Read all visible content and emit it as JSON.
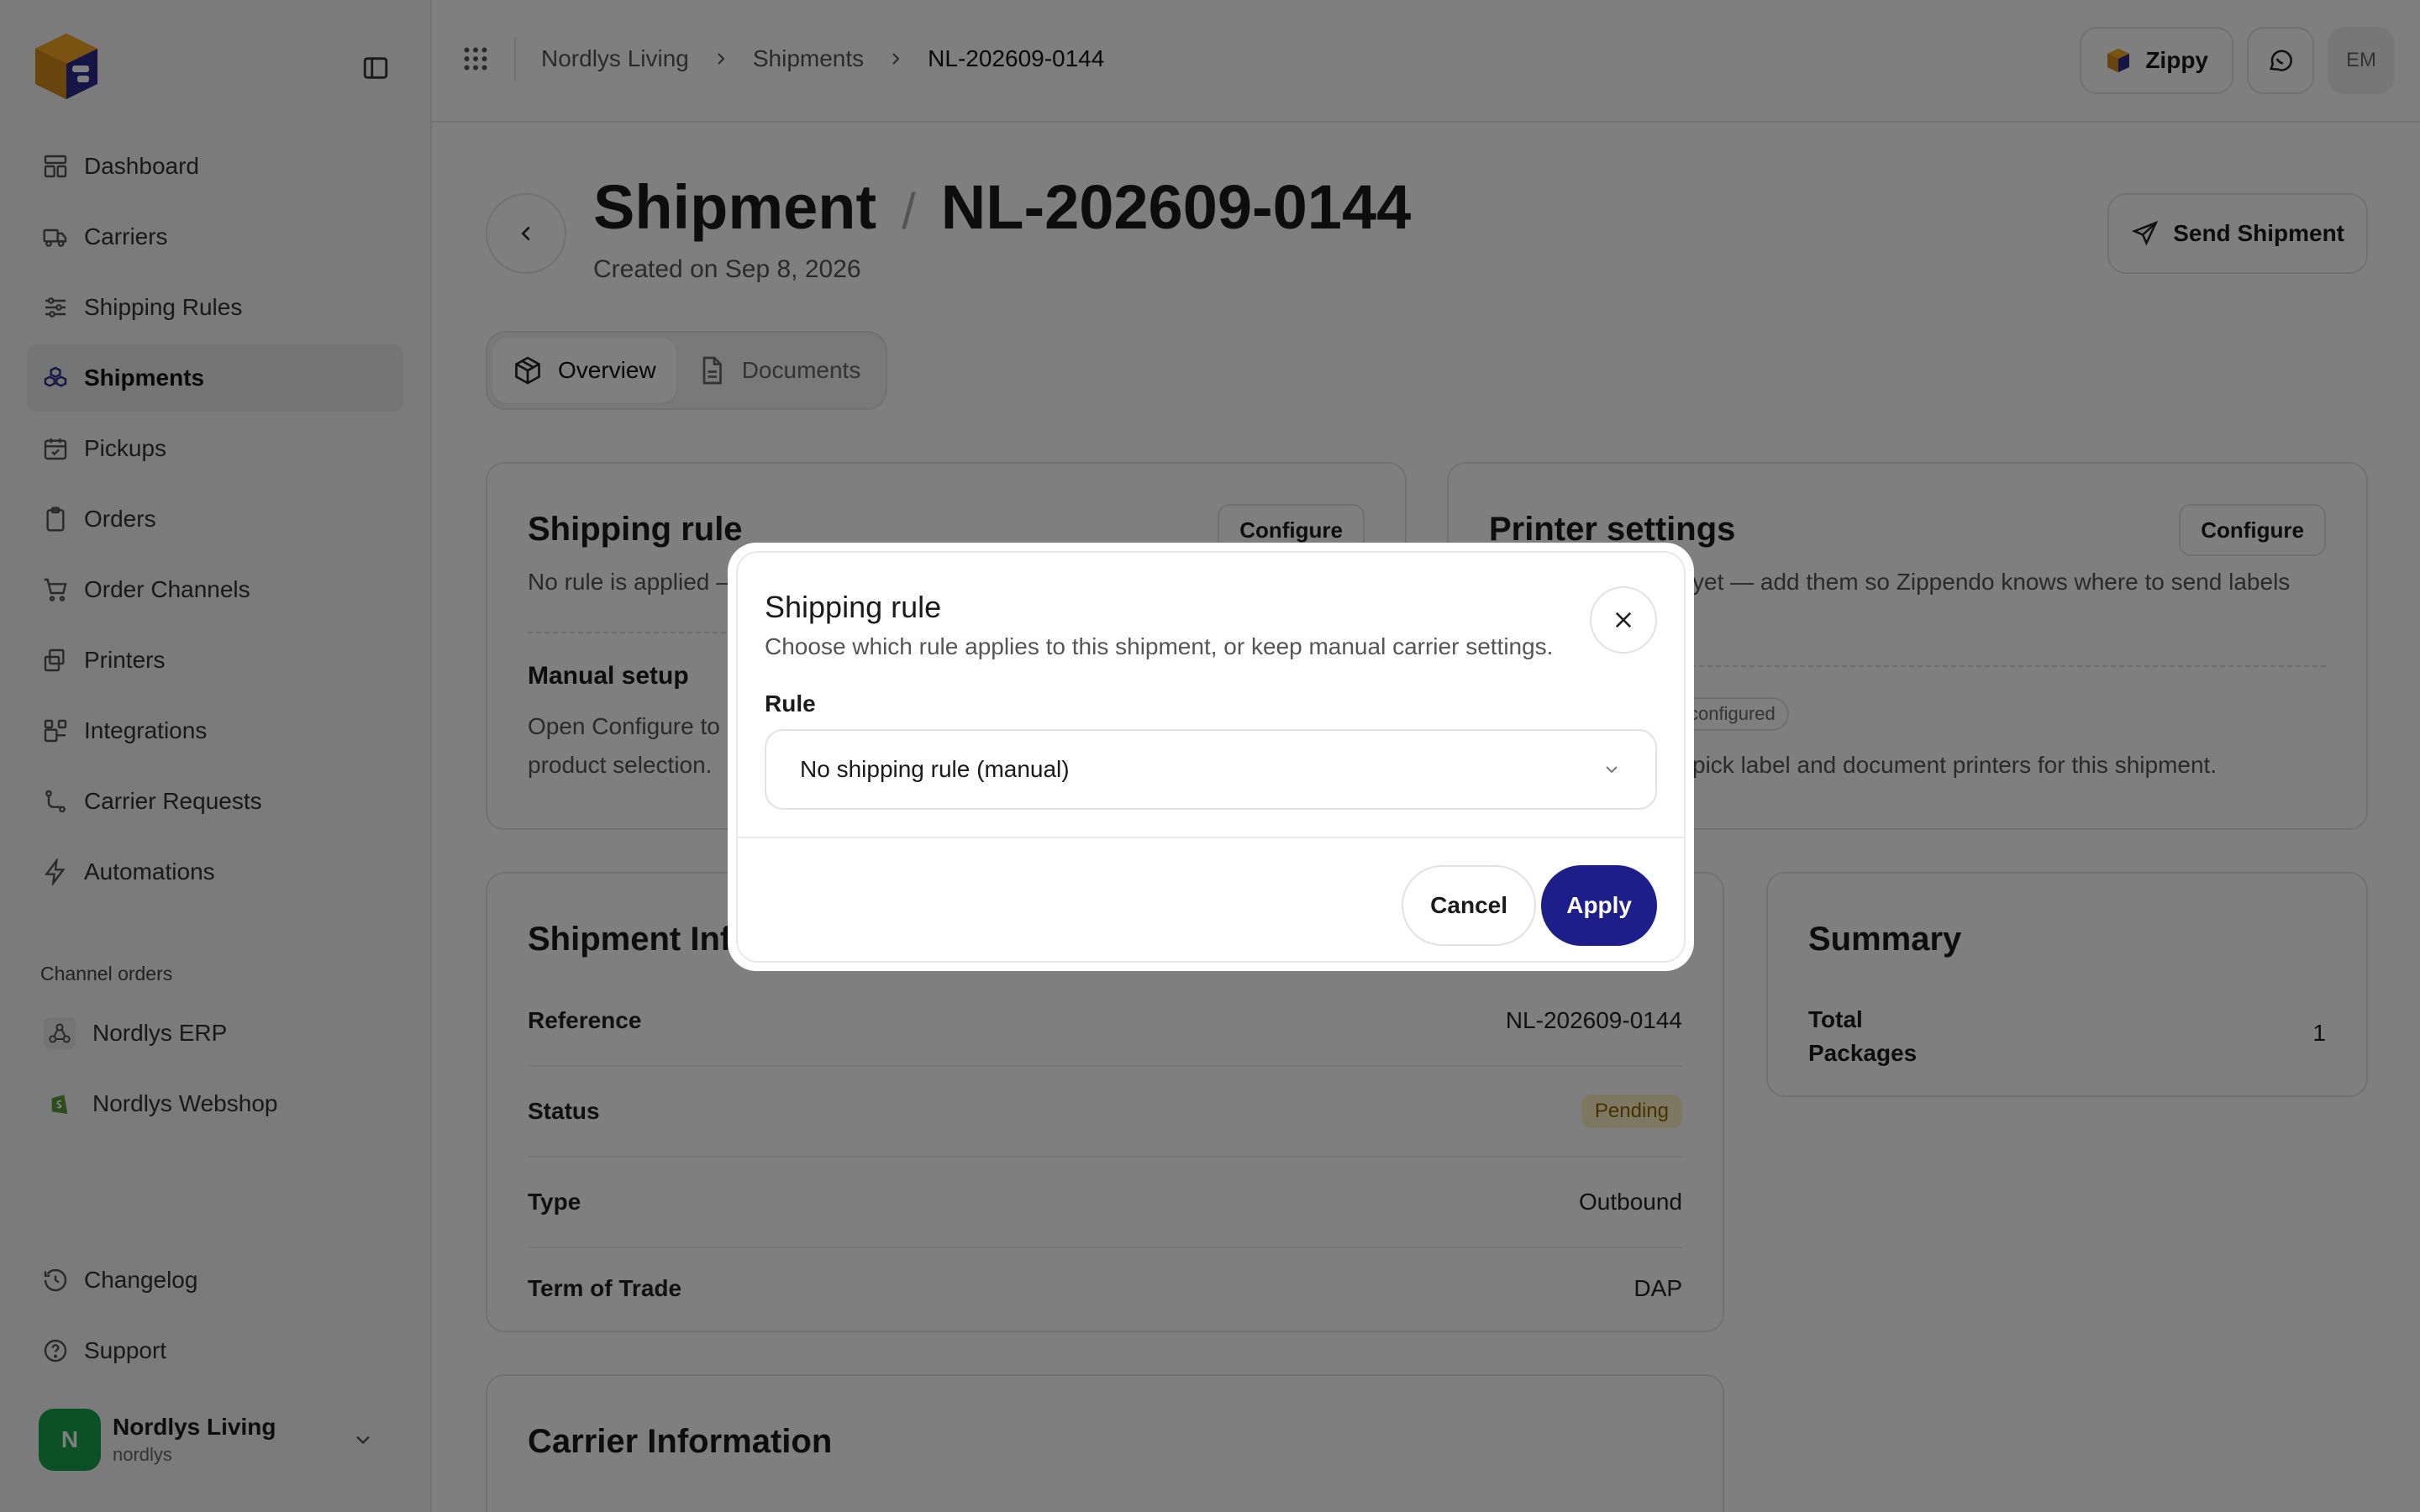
{
  "sidebar": {
    "items": [
      {
        "label": "Dashboard",
        "icon": "dashboard-icon"
      },
      {
        "label": "Carriers",
        "icon": "truck-icon"
      },
      {
        "label": "Shipping Rules",
        "icon": "sliders-icon"
      },
      {
        "label": "Shipments",
        "icon": "boxes-icon",
        "active": true
      },
      {
        "label": "Pickups",
        "icon": "calendar-check-icon"
      },
      {
        "label": "Orders",
        "icon": "clipboard-icon"
      },
      {
        "label": "Order Channels",
        "icon": "cart-icon"
      },
      {
        "label": "Printers",
        "icon": "printer-icon"
      },
      {
        "label": "Integrations",
        "icon": "blocks-icon"
      },
      {
        "label": "Carrier Requests",
        "icon": "route-icon"
      },
      {
        "label": "Automations",
        "icon": "zap-icon"
      }
    ],
    "section_label": "Channel orders",
    "channels": [
      {
        "label": "Nordlys ERP",
        "icon": "webhook-icon"
      },
      {
        "label": "Nordlys Webshop",
        "icon": "shopify-icon"
      }
    ],
    "bottom": [
      {
        "label": "Changelog",
        "icon": "history-icon"
      },
      {
        "label": "Support",
        "icon": "help-icon"
      }
    ],
    "account": {
      "initial": "N",
      "name": "Nordlys Living",
      "handle": "nordlys"
    }
  },
  "topbar": {
    "breadcrumbs": [
      "Nordlys Living",
      "Shipments",
      "NL-202609-0144"
    ],
    "zippy_label": "Zippy",
    "user_initials": "EM"
  },
  "header": {
    "title_prefix": "Shipment",
    "separator": "/",
    "title_id": "NL-202609-0144",
    "created": "Created on Sep 8, 2026",
    "send_label": "Send Shipment"
  },
  "tabs": [
    {
      "label": "Overview",
      "active": true
    },
    {
      "label": "Documents",
      "active": false
    }
  ],
  "shipping_rule_card": {
    "title": "Shipping rule",
    "configure": "Configure",
    "text": "No rule is applied —",
    "manual_title": "Manual setup",
    "manual_text_1": "Open Configure to p",
    "manual_text_2": "product selection."
  },
  "printer_card": {
    "title": "Printer settings",
    "configure": "Configure",
    "text": "yet — add them so Zippendo knows where to send labels",
    "pill": "configured",
    "text2": "pick label and document printers for this shipment."
  },
  "shipment_info": {
    "title": "Shipment Info",
    "rows": [
      {
        "key": "Reference",
        "value": "NL-202609-0144"
      },
      {
        "key": "Status",
        "value": "Pending"
      },
      {
        "key": "Type",
        "value": "Outbound"
      },
      {
        "key": "Term of Trade",
        "value": "DAP"
      }
    ]
  },
  "summary": {
    "title": "Summary",
    "label_1": "Total",
    "label_2": "Packages",
    "value": "1"
  },
  "carrier_info": {
    "title": "Carrier Information"
  },
  "modal": {
    "title": "Shipping rule",
    "description": "Choose which rule applies to this shipment, or keep manual carrier settings.",
    "field_label": "Rule",
    "selected_value": "No shipping rule (manual)",
    "cancel": "Cancel",
    "apply": "Apply"
  },
  "colors": {
    "accent": "#1e1e8a",
    "account_green": "#16a34a",
    "pending_bg": "#fdf1c7",
    "pending_text": "#8a6500"
  }
}
